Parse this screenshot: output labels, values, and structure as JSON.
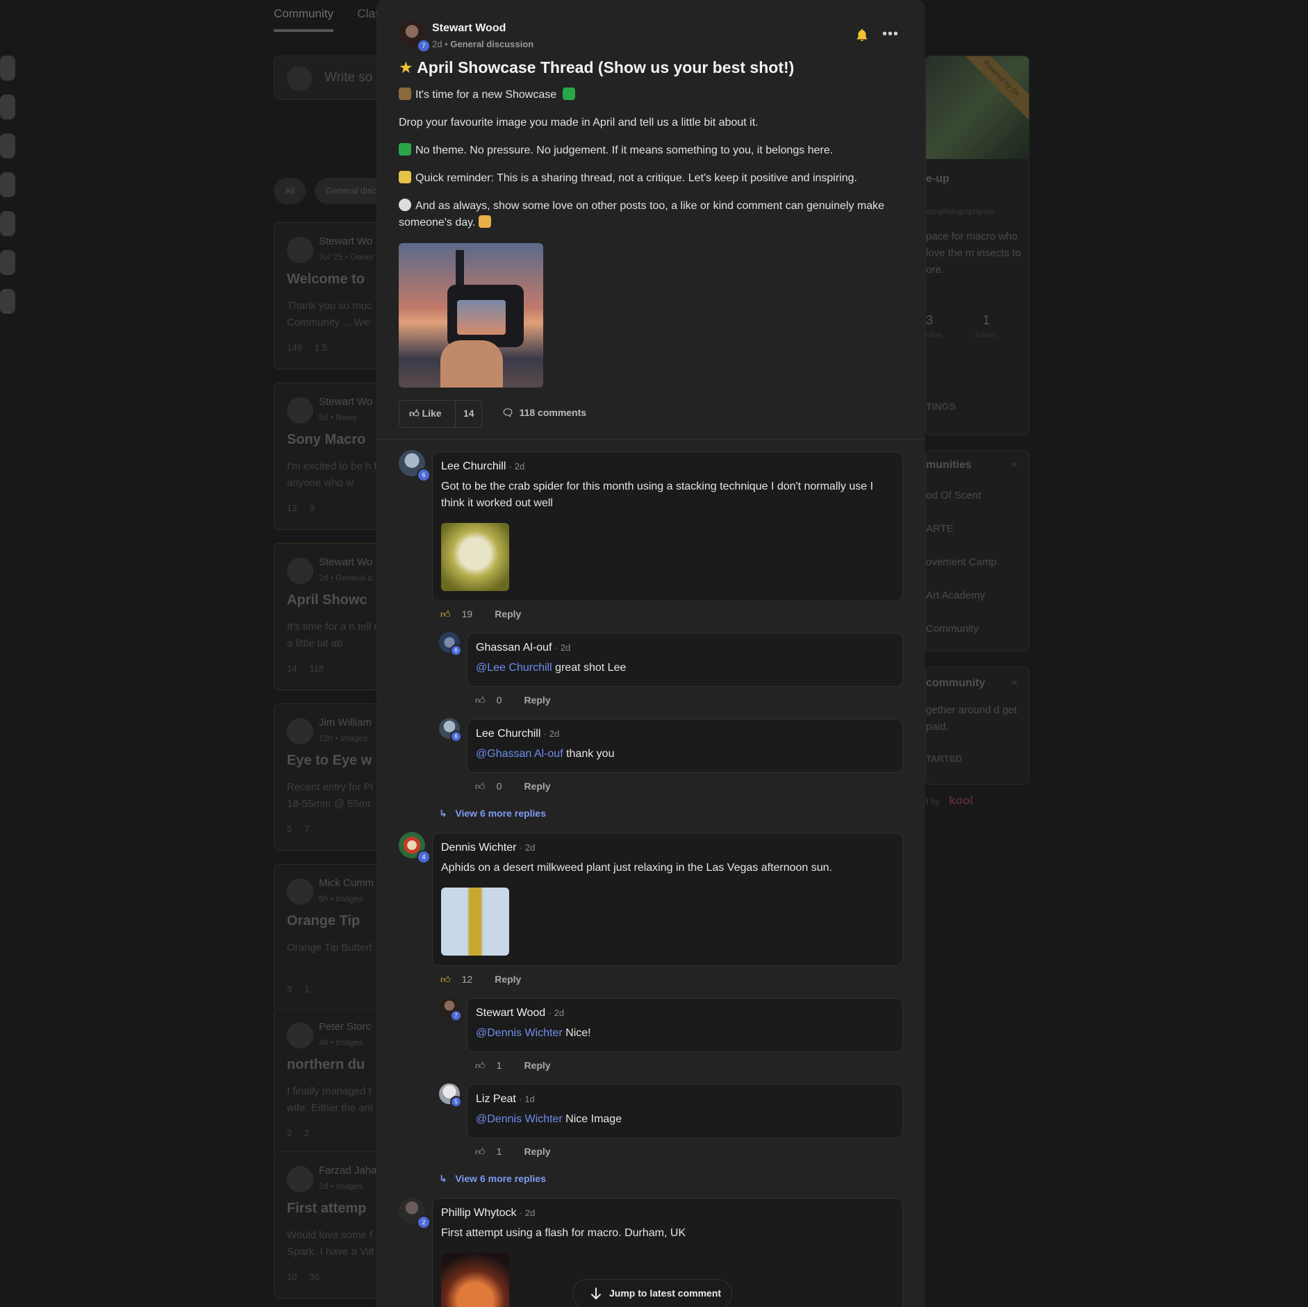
{
  "background": {
    "tabs": [
      "Community",
      "Clas"
    ],
    "composer_placeholder": "Write so",
    "filter_chips": [
      "All",
      "General disc"
    ],
    "feed_cards": [
      {
        "author": "Stewart Wo",
        "meta": "Jul '25 • Gener",
        "title": "Welcome to",
        "body": "Thank you so muc Community ... We'",
        "likes": "149",
        "comments": "1.5"
      },
      {
        "author": "Stewart Wo",
        "meta": "5d • News",
        "title": "Sony Macro",
        "body": "I'm excited to be h for anyone who w",
        "likes": "13",
        "comments": "9"
      },
      {
        "author": "Stewart Wo",
        "meta": "2d • General d",
        "title": "April Showc",
        "body": "It's time for a n tell us a little bit ab",
        "likes": "14",
        "comments": "118"
      },
      {
        "author": "Jim William",
        "meta": "12h • Images",
        "title": "Eye to Eye w",
        "body": "Recent entry for Pi 18-55mm @ 55mr",
        "likes": "5",
        "comments": "7"
      },
      {
        "author": "Mick Cumm",
        "meta": "6h • Images",
        "title": "Orange Tip",
        "body": "Orange Tip Butterf",
        "likes": "3",
        "comments": "1"
      },
      {
        "author": "Peter Storc",
        "meta": "4h • Images",
        "title": "northern du",
        "body": "I finally managed t wife. Either the ani",
        "likes": "2",
        "comments": "2"
      },
      {
        "author": "Farzad Jaha",
        "meta": "2d • Images",
        "title": "First attemp",
        "body": "Would love some f Spark. I have a Vilt",
        "likes": "10",
        "comments": "36"
      }
    ],
    "about": {
      "ribbon": "Powered by SK",
      "name": "e-up",
      "url": "cro-photography-wo...",
      "desc": "pace for macro who love the m insects to ore.",
      "stats": [
        {
          "value": "3",
          "label": "nline"
        },
        {
          "value": "1",
          "label": "Admin"
        }
      ],
      "settings": "TINGS"
    },
    "communities": {
      "title": "munities",
      "items": [
        "od Of Scent",
        "ARTE",
        "ovement Camp",
        "Art Academy",
        "Community"
      ]
    },
    "promo": {
      "title": "community",
      "body": "gether around d get paid.",
      "cta": "TARTED"
    },
    "powered_by": "d by",
    "brand": "kool"
  },
  "post": {
    "author": "Stewart Wood",
    "author_level": "7",
    "age": "2d",
    "category": "General discussion",
    "title": "April Showcase Thread (Show us your best shot!)",
    "paragraphs": [
      "It's time for a new Showcase",
      "Drop your favourite image you made in April and tell us a little bit about it.",
      "No theme. No pressure. No judgement. If it means something to you, it belongs here.",
      "Quick reminder: This is a sharing thread, not a critique. Let's keep it positive and inspiring.",
      "And as always, show some love on other posts too, a like or kind comment can genuinely make someone's day."
    ],
    "like_label": "Like",
    "like_count": "14",
    "comments_label": "118 comments"
  },
  "comments": [
    {
      "author": "Lee Churchill",
      "level": "6",
      "age": "2d",
      "text": "Got to be the crab spider for this month using a stacking technique I don't normally use I think it worked out well",
      "likes": "19",
      "reply": "Reply",
      "replies": [
        {
          "author": "Ghassan Al-ouf",
          "level": "6",
          "age": "2d",
          "mention": "@Lee Churchill",
          "text": " great shot Lee",
          "likes": "0",
          "reply": "Reply"
        },
        {
          "author": "Lee Churchill",
          "level": "6",
          "age": "2d",
          "mention": "@Ghassan Al-ouf",
          "text": " thank you",
          "likes": "0",
          "reply": "Reply"
        }
      ],
      "more": "View 6 more replies"
    },
    {
      "author": "Dennis Wichter",
      "level": "4",
      "age": "2d",
      "text": "Aphids on a desert milkweed plant just relaxing in the Las Vegas afternoon sun.",
      "likes": "12",
      "reply": "Reply",
      "replies": [
        {
          "author": "Stewart Wood",
          "level": "7",
          "age": "2d",
          "mention": "@Dennis Wichter",
          "text": " Nice!",
          "likes": "1",
          "reply": "Reply"
        },
        {
          "author": "Liz Peat",
          "level": "5",
          "age": "1d",
          "mention": "@Dennis Wichter",
          "text": " Nice Image",
          "likes": "1",
          "reply": "Reply"
        }
      ],
      "more": "View 6 more replies"
    },
    {
      "author": "Phillip Whytock",
      "level": "2",
      "age": "2d",
      "text": "First attempt using a flash for macro. Durham, UK"
    }
  ],
  "jump_label": "Jump to latest comment",
  "colors": {
    "accent": "#6e8ef0",
    "level_badge": "#4a6ad8",
    "like_active": "#f2c230",
    "bell": "#f2c230"
  },
  "icons": [
    "bell-icon",
    "more-icon",
    "thumbs-up-icon",
    "comment-icon",
    "reply-arrow-icon",
    "arrow-down-icon"
  ]
}
